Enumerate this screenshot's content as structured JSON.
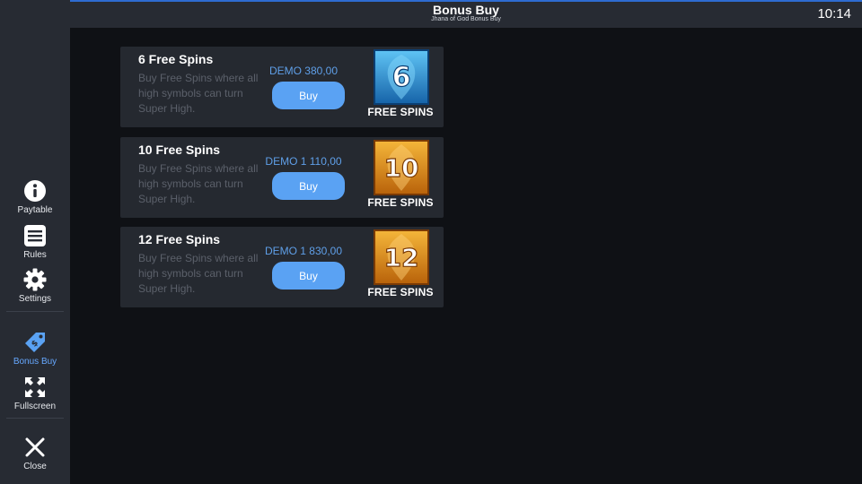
{
  "header": {
    "title": "Bonus Buy",
    "subtitle": "Jhana of God Bonus Buy",
    "clock": "10:14"
  },
  "sidebar": {
    "items": [
      {
        "label": "Paytable",
        "icon": "info-icon"
      },
      {
        "label": "Rules",
        "icon": "rules-icon"
      },
      {
        "label": "Settings",
        "icon": "gear-icon"
      },
      {
        "label": "Bonus Buy",
        "icon": "tag-icon",
        "active": true
      },
      {
        "label": "Fullscreen",
        "icon": "fullscreen-icon"
      },
      {
        "label": "Close",
        "icon": "close-icon"
      }
    ]
  },
  "offers": [
    {
      "title": "6 Free Spins",
      "description": "Buy Free Spins where all high symbols can turn Super High.",
      "price": "DEMO 380,00",
      "button": "Buy",
      "badge_number": "6",
      "badge_label": "FREE SPINS",
      "badge_color": "#2a8fd0"
    },
    {
      "title": "10 Free Spins",
      "description": "Buy Free Spins where all high symbols can turn Super High.",
      "price": "DEMO 1 110,00",
      "button": "Buy",
      "badge_number": "10",
      "badge_label": "FREE SPINS",
      "badge_color": "#d98a12"
    },
    {
      "title": "12 Free Spins",
      "description": "Buy Free Spins where all high symbols can turn Super High.",
      "price": "DEMO 1 830,00",
      "button": "Buy",
      "badge_number": "12",
      "badge_label": "FREE SPINS",
      "badge_color": "#d98a12"
    }
  ],
  "colors": {
    "accent": "#5aa2f3",
    "active_nav": "#66a8ff"
  }
}
